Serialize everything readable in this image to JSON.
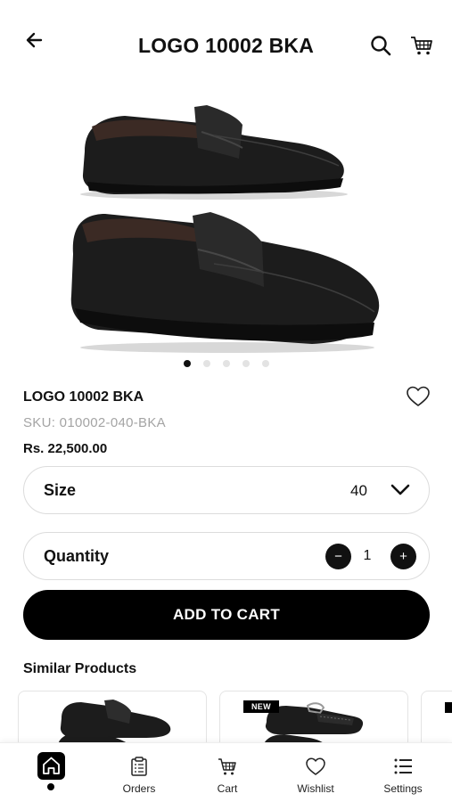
{
  "header": {
    "title": "LOGO 10002 BKA",
    "icons": [
      "back-arrow-icon",
      "search-icon",
      "cart-icon"
    ]
  },
  "gallery": {
    "image_count": 5,
    "active_index": 0
  },
  "product": {
    "name": "LOGO 10002 BKA",
    "sku": "SKU: 010002-040-BKA",
    "price": "Rs. 22,500.00"
  },
  "size": {
    "label": "Size",
    "value": "40"
  },
  "quantity": {
    "label": "Quantity",
    "value": "1",
    "minus": "−",
    "plus": "+"
  },
  "add_to_cart": "ADD TO CART",
  "similar": {
    "title": "Similar Products",
    "cards": [
      {
        "badge": ""
      },
      {
        "badge": "NEW"
      }
    ]
  },
  "tabbar": {
    "items": [
      {
        "label": "",
        "icon": "home-icon",
        "active": true
      },
      {
        "label": "Orders",
        "icon": "orders-icon"
      },
      {
        "label": "Cart",
        "icon": "cart-icon"
      },
      {
        "label": "Wishlist",
        "icon": "heart-icon"
      },
      {
        "label": "Settings",
        "icon": "list-icon"
      }
    ]
  },
  "colors": {
    "accent": "#000000",
    "muted_text": "#a4a4a4",
    "border": "#dcdcdc"
  }
}
